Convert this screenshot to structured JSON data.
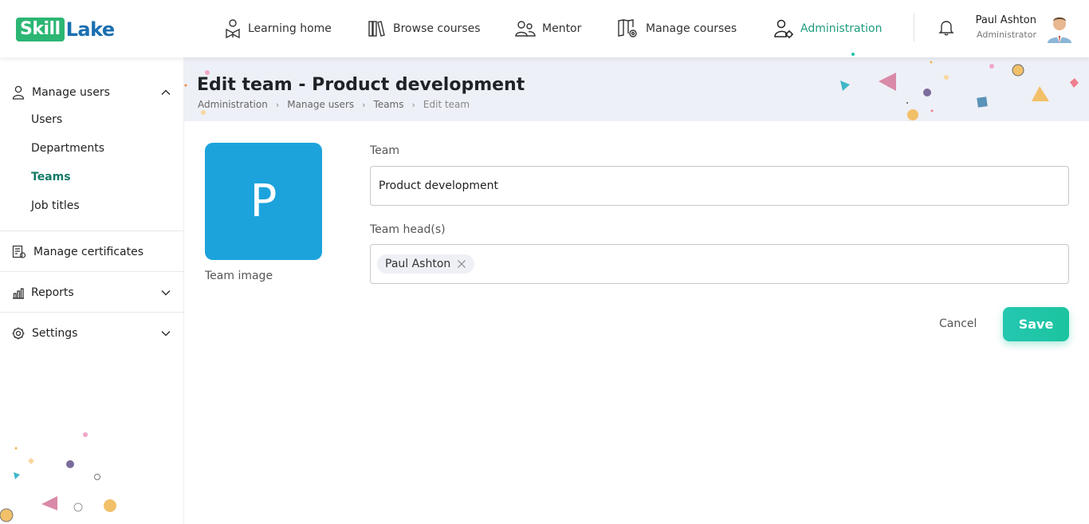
{
  "app": {
    "logo_box": "Skill",
    "logo_rest": "Lake"
  },
  "nav": [
    {
      "label": "Learning home",
      "icon": "learning-home-icon"
    },
    {
      "label": "Browse courses",
      "icon": "books-icon"
    },
    {
      "label": "Mentor",
      "icon": "mentor-icon"
    },
    {
      "label": "Manage courses",
      "icon": "manage-courses-icon"
    },
    {
      "label": "Administration",
      "icon": "admin-user-icon",
      "active": true
    }
  ],
  "user": {
    "name": "Paul Ashton",
    "role": "Administrator"
  },
  "sidebar": {
    "manage_users": "Manage users",
    "sub_items": [
      "Users",
      "Departments",
      "Teams",
      "Job titles"
    ],
    "active_sub": "Teams",
    "manage_certificates": "Manage certificates",
    "reports": "Reports",
    "settings": "Settings"
  },
  "page": {
    "title": "Edit team - Product development",
    "breadcrumb": [
      "Administration",
      "Manage users",
      "Teams",
      "Edit team"
    ]
  },
  "form": {
    "team_initial": "P",
    "team_image_label": "Team image",
    "team_label": "Team",
    "team_value": "Product development",
    "team_heads_label": "Team head(s)",
    "team_heads": [
      "Paul Ashton"
    ],
    "cancel_label": "Cancel",
    "save_label": "Save"
  },
  "colors": {
    "accent": "#1e9c7e",
    "save": "#1cc4a0",
    "team_image_bg": "#1ca3dc",
    "banner_bg": "#eef0f7"
  }
}
